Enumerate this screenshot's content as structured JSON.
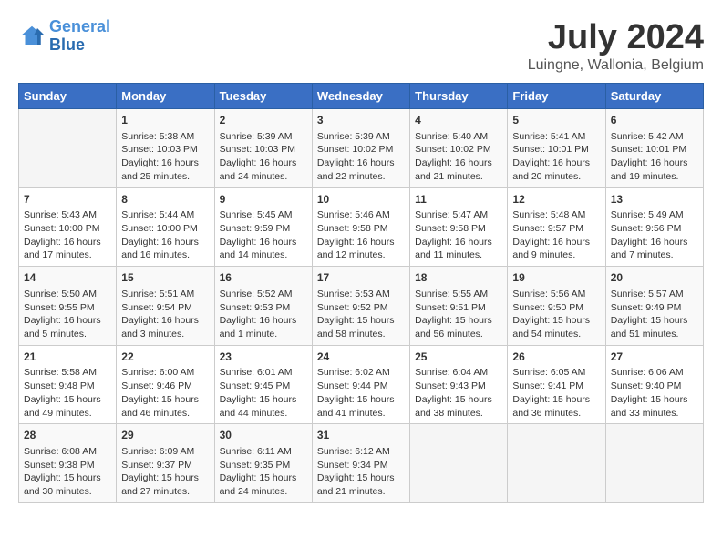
{
  "header": {
    "logo_line1": "General",
    "logo_line2": "Blue",
    "month": "July 2024",
    "location": "Luingne, Wallonia, Belgium"
  },
  "columns": [
    "Sunday",
    "Monday",
    "Tuesday",
    "Wednesday",
    "Thursday",
    "Friday",
    "Saturday"
  ],
  "weeks": [
    [
      {
        "day": "",
        "info": ""
      },
      {
        "day": "1",
        "info": "Sunrise: 5:38 AM\nSunset: 10:03 PM\nDaylight: 16 hours\nand 25 minutes."
      },
      {
        "day": "2",
        "info": "Sunrise: 5:39 AM\nSunset: 10:03 PM\nDaylight: 16 hours\nand 24 minutes."
      },
      {
        "day": "3",
        "info": "Sunrise: 5:39 AM\nSunset: 10:02 PM\nDaylight: 16 hours\nand 22 minutes."
      },
      {
        "day": "4",
        "info": "Sunrise: 5:40 AM\nSunset: 10:02 PM\nDaylight: 16 hours\nand 21 minutes."
      },
      {
        "day": "5",
        "info": "Sunrise: 5:41 AM\nSunset: 10:01 PM\nDaylight: 16 hours\nand 20 minutes."
      },
      {
        "day": "6",
        "info": "Sunrise: 5:42 AM\nSunset: 10:01 PM\nDaylight: 16 hours\nand 19 minutes."
      }
    ],
    [
      {
        "day": "7",
        "info": "Sunrise: 5:43 AM\nSunset: 10:00 PM\nDaylight: 16 hours\nand 17 minutes."
      },
      {
        "day": "8",
        "info": "Sunrise: 5:44 AM\nSunset: 10:00 PM\nDaylight: 16 hours\nand 16 minutes."
      },
      {
        "day": "9",
        "info": "Sunrise: 5:45 AM\nSunset: 9:59 PM\nDaylight: 16 hours\nand 14 minutes."
      },
      {
        "day": "10",
        "info": "Sunrise: 5:46 AM\nSunset: 9:58 PM\nDaylight: 16 hours\nand 12 minutes."
      },
      {
        "day": "11",
        "info": "Sunrise: 5:47 AM\nSunset: 9:58 PM\nDaylight: 16 hours\nand 11 minutes."
      },
      {
        "day": "12",
        "info": "Sunrise: 5:48 AM\nSunset: 9:57 PM\nDaylight: 16 hours\nand 9 minutes."
      },
      {
        "day": "13",
        "info": "Sunrise: 5:49 AM\nSunset: 9:56 PM\nDaylight: 16 hours\nand 7 minutes."
      }
    ],
    [
      {
        "day": "14",
        "info": "Sunrise: 5:50 AM\nSunset: 9:55 PM\nDaylight: 16 hours\nand 5 minutes."
      },
      {
        "day": "15",
        "info": "Sunrise: 5:51 AM\nSunset: 9:54 PM\nDaylight: 16 hours\nand 3 minutes."
      },
      {
        "day": "16",
        "info": "Sunrise: 5:52 AM\nSunset: 9:53 PM\nDaylight: 16 hours\nand 1 minute."
      },
      {
        "day": "17",
        "info": "Sunrise: 5:53 AM\nSunset: 9:52 PM\nDaylight: 15 hours\nand 58 minutes."
      },
      {
        "day": "18",
        "info": "Sunrise: 5:55 AM\nSunset: 9:51 PM\nDaylight: 15 hours\nand 56 minutes."
      },
      {
        "day": "19",
        "info": "Sunrise: 5:56 AM\nSunset: 9:50 PM\nDaylight: 15 hours\nand 54 minutes."
      },
      {
        "day": "20",
        "info": "Sunrise: 5:57 AM\nSunset: 9:49 PM\nDaylight: 15 hours\nand 51 minutes."
      }
    ],
    [
      {
        "day": "21",
        "info": "Sunrise: 5:58 AM\nSunset: 9:48 PM\nDaylight: 15 hours\nand 49 minutes."
      },
      {
        "day": "22",
        "info": "Sunrise: 6:00 AM\nSunset: 9:46 PM\nDaylight: 15 hours\nand 46 minutes."
      },
      {
        "day": "23",
        "info": "Sunrise: 6:01 AM\nSunset: 9:45 PM\nDaylight: 15 hours\nand 44 minutes."
      },
      {
        "day": "24",
        "info": "Sunrise: 6:02 AM\nSunset: 9:44 PM\nDaylight: 15 hours\nand 41 minutes."
      },
      {
        "day": "25",
        "info": "Sunrise: 6:04 AM\nSunset: 9:43 PM\nDaylight: 15 hours\nand 38 minutes."
      },
      {
        "day": "26",
        "info": "Sunrise: 6:05 AM\nSunset: 9:41 PM\nDaylight: 15 hours\nand 36 minutes."
      },
      {
        "day": "27",
        "info": "Sunrise: 6:06 AM\nSunset: 9:40 PM\nDaylight: 15 hours\nand 33 minutes."
      }
    ],
    [
      {
        "day": "28",
        "info": "Sunrise: 6:08 AM\nSunset: 9:38 PM\nDaylight: 15 hours\nand 30 minutes."
      },
      {
        "day": "29",
        "info": "Sunrise: 6:09 AM\nSunset: 9:37 PM\nDaylight: 15 hours\nand 27 minutes."
      },
      {
        "day": "30",
        "info": "Sunrise: 6:11 AM\nSunset: 9:35 PM\nDaylight: 15 hours\nand 24 minutes."
      },
      {
        "day": "31",
        "info": "Sunrise: 6:12 AM\nSunset: 9:34 PM\nDaylight: 15 hours\nand 21 minutes."
      },
      {
        "day": "",
        "info": ""
      },
      {
        "day": "",
        "info": ""
      },
      {
        "day": "",
        "info": ""
      }
    ]
  ]
}
